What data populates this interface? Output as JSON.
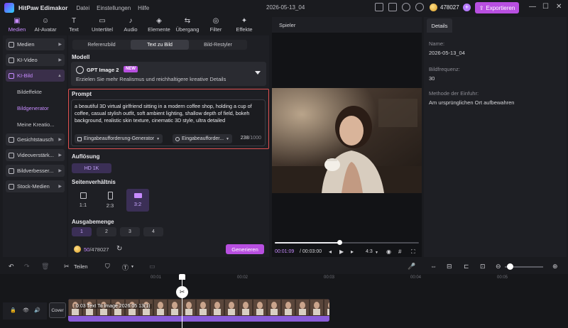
{
  "app": {
    "title": "HitPaw Edimakor",
    "menus": [
      "Datei",
      "Einstellungen",
      "Hilfe"
    ],
    "project": "2026-05-13_04",
    "coins": "478027",
    "plus": "+",
    "export_label": "Exportieren"
  },
  "tooltabs": [
    {
      "label": "Medien",
      "icon": "folder-icon",
      "glyph": "▣"
    },
    {
      "label": "AI-Avatar",
      "icon": "avatar-icon",
      "glyph": "☺"
    },
    {
      "label": "Text",
      "icon": "text-icon",
      "glyph": "T"
    },
    {
      "label": "Untertitel",
      "icon": "subtitle-icon",
      "glyph": "▭"
    },
    {
      "label": "Audio",
      "icon": "music-icon",
      "glyph": "♪"
    },
    {
      "label": "Elemente",
      "icon": "elements-icon",
      "glyph": "◈"
    },
    {
      "label": "Übergang",
      "icon": "transition-icon",
      "glyph": "⇆"
    },
    {
      "label": "Filter",
      "icon": "filter-icon",
      "glyph": "◎"
    },
    {
      "label": "Effekte",
      "icon": "effects-icon",
      "glyph": "✦"
    }
  ],
  "sidebar": {
    "items": [
      {
        "label": "Medien"
      },
      {
        "label": "KI-Video"
      },
      {
        "label": "KI-Bild"
      },
      {
        "label": "Gesichtstausch"
      },
      {
        "label": "Videoverstärk..."
      },
      {
        "label": "Bildverbesser..."
      },
      {
        "label": "Stock-Medien"
      }
    ],
    "subitems": [
      "Bildeffekte",
      "Bildgenerator",
      "Meine Kreatio..."
    ]
  },
  "panel": {
    "segments": [
      "Referenzbild",
      "Text zu Bild",
      "Bild-Restyler"
    ],
    "model_title": "Modell",
    "model_name": "GPT Image 2",
    "model_badge": "NEW",
    "model_desc": "Erzielen Sie mehr Realismus und reichhaltigere kreative Details",
    "prompt_title": "Prompt",
    "prompt_text": "a beautiful 3D virtual girlfriend sitting in a modern coffee shop, holding a cup of coffee, casual stylish outfit, soft ambient lighting, shallow depth of field, bokeh background, realistic skin texture, cinematic 3D style, ultra detailed",
    "chip1": "Eingabeaufforderung-Generator",
    "chip2": "Eingabeaufforder...",
    "char_used": "238",
    "char_max": "/1000",
    "res_title": "Auflösung",
    "res_value": "HD 1K",
    "ar_title": "Seitenverhältnis",
    "ar_options": [
      "1:1",
      "2:3",
      "3:2"
    ],
    "count_title": "Ausgabemenge",
    "count_options": [
      "1",
      "2",
      "3",
      "4"
    ],
    "credits_used": "50",
    "credits_total": "/478027",
    "generate_label": "Generieren"
  },
  "player": {
    "title": "Spieler",
    "time_current": "00:01:09",
    "time_total": "/ 00:03:00",
    "ratio": "4:3",
    "progress": 0.45
  },
  "details": {
    "tab": "Details",
    "name_label": "Name:",
    "name_value": "2026-05-13_04",
    "fps_label": "Bildfrequenz:",
    "fps_value": "30",
    "method_label": "Methode der Einfuhr:",
    "method_value": "Am ursprünglichen Ort aufbewahren"
  },
  "timeline": {
    "split_label": "Teilen",
    "ruler": [
      "00:01",
      "00:02",
      "00:03",
      "00:04",
      "00:05"
    ],
    "cover_label": "Cover",
    "clip_label": "0:03 Text To Image 2026 05 13(1)"
  },
  "colors": {
    "accent": "#b84fe0",
    "accent_light": "#c78bff",
    "highlight": "#e05050"
  }
}
